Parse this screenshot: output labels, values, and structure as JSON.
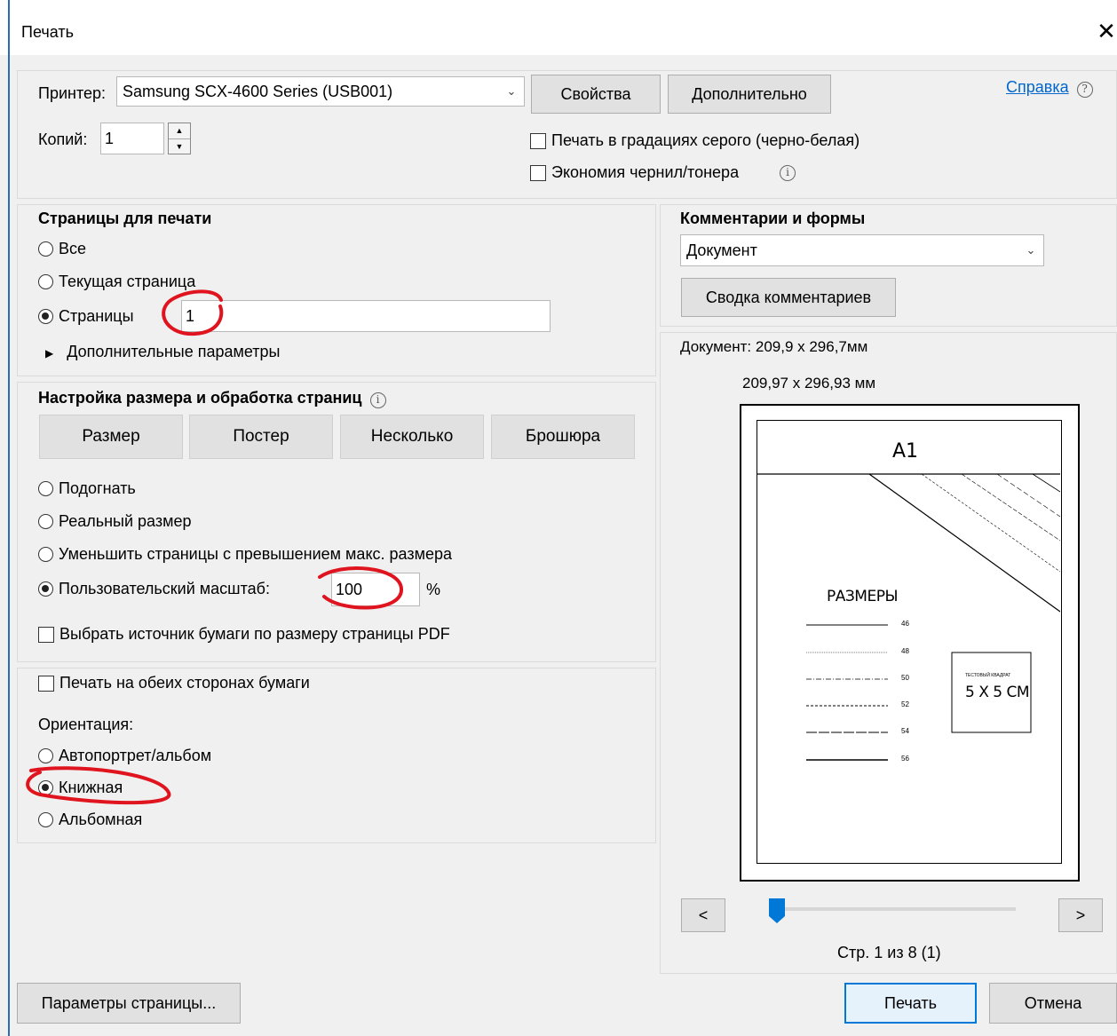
{
  "window": {
    "title": "Печать",
    "close_glyph": "✕"
  },
  "printer": {
    "label": "Принтер:",
    "selected": "Samsung SCX-4600 Series (USB001)",
    "properties_btn": "Свойства",
    "advanced_btn": "Дополнительно",
    "help_link": "Справка",
    "copies_label": "Копий:",
    "copies_value": "1",
    "grayscale_label": "Печать в градациях серого (черно-белая)",
    "save_ink_label": "Экономия чернил/тонера"
  },
  "pages": {
    "title": "Страницы для печати",
    "all": "Все",
    "current": "Текущая страница",
    "pages": "Страницы",
    "pages_value": "1",
    "more": "Дополнительные параметры"
  },
  "sizing": {
    "title": "Настройка размера и обработка страниц",
    "tabs": [
      "Размер",
      "Постер",
      "Несколько",
      "Брошюра"
    ],
    "fit": "Подогнать",
    "actual": "Реальный размер",
    "shrink": "Уменьшить страницы с превышением макс. размера",
    "custom": "Пользовательский масштаб:",
    "custom_value": "100",
    "percent": "%",
    "paper_source": "Выбрать источник бумаги по размеру страницы PDF"
  },
  "duplex": {
    "both_sides": "Печать на обеих сторонах бумаги",
    "orientation_label": "Ориентация:",
    "auto": "Автопортрет/альбом",
    "portrait": "Книжная",
    "landscape": "Альбомная"
  },
  "comments": {
    "title": "Комментарии и формы",
    "selected": "Документ",
    "summary_btn": "Сводка комментариев"
  },
  "preview": {
    "doc_size": "Документ: 209,9 x 296,7мм",
    "paper_size": "209,97 x 296,93 мм",
    "page_title": "A1",
    "sizes_heading": "РАЗМЕРЫ",
    "size_labels": [
      "46",
      "48",
      "50",
      "52",
      "54",
      "56"
    ],
    "box_caption": "ТЕСТОВЫЙ КВАДРАТ",
    "box_text": "5 X 5 СМ",
    "prev": "<",
    "next": ">",
    "page_counter": "Стр. 1 из 8 (1)",
    "slider_position": 0
  },
  "footer": {
    "page_setup": "Параметры страницы...",
    "print": "Печать",
    "cancel": "Отмена"
  },
  "colors": {
    "accent": "#0078d7",
    "annotation": "#e0141e",
    "link": "#0066cc"
  }
}
